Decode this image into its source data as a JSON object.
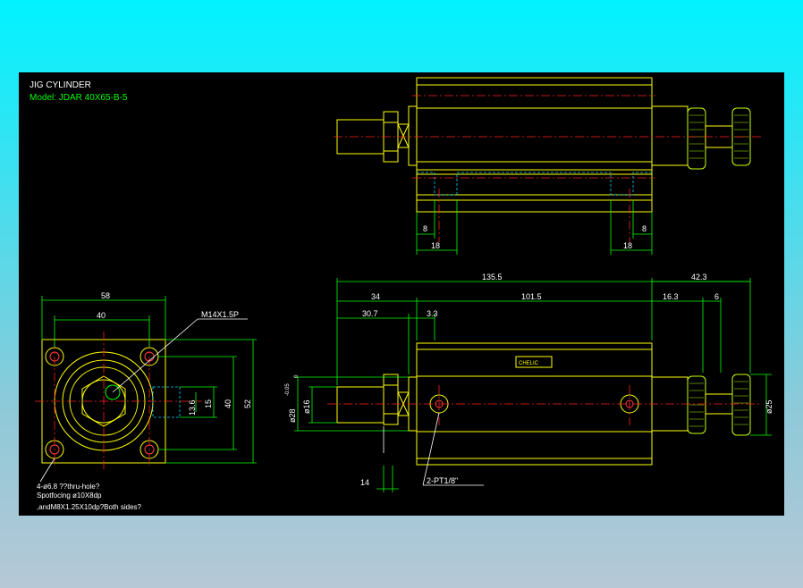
{
  "title": "JIG CYLINDER",
  "model": "Model: JDAR 40X65-B-5",
  "top_view": {
    "dim_left_8": "8",
    "dim_left_18": "18",
    "dim_right_8": "8",
    "dim_right_18": "18"
  },
  "side_view": {
    "dim_total": "135.5",
    "dim_rod_ext": "42.3",
    "dim_front": "34",
    "dim_body": "101.5",
    "dim_30_7": "30.7",
    "dim_3_3": "3.3",
    "dim_16_3": "16.3",
    "dim_6": "6",
    "dim_phi28": "ø28",
    "dim_phi28_tol": "-0.05",
    "dim_phi28_tol0": "0",
    "dim_phi16": "ø16",
    "dim_phi25": "ø25",
    "dim_14": "14",
    "port_label": "2-PT1/8\"",
    "brand": "CHELIC"
  },
  "end_view": {
    "dim_58": "58",
    "dim_40": "40",
    "dim_52": "52",
    "dim_40v": "40",
    "dim_15": "15",
    "dim_13_6": "13.6",
    "thread_label": "M14X1.5P",
    "note_1": "4-ø6.8 ??thru-hole?",
    "note_2": "Spotfocing  ø10X8dp",
    "note_3": ",andM8X1.25X10dp?Both sides?"
  }
}
